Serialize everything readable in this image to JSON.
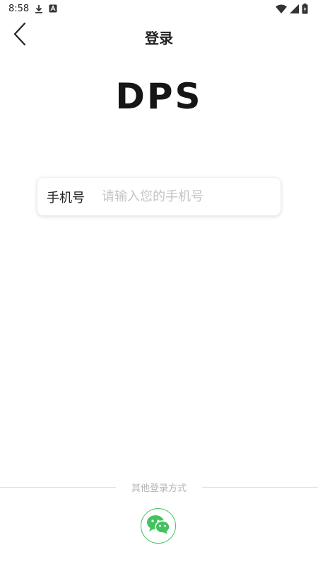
{
  "status_bar": {
    "time": "8:58"
  },
  "nav": {
    "title": "登录"
  },
  "logo": {
    "text": "DPS"
  },
  "phone": {
    "label": "手机号",
    "placeholder": "请输入您的手机号",
    "value": ""
  },
  "other_login": {
    "label": "其他登录方式"
  },
  "colors": {
    "wechat_green": "#43c25d",
    "divider": "#dcdcdc",
    "placeholder": "#c4c4c4"
  },
  "icons": [
    "download-icon",
    "app-notification-icon",
    "wifi-icon",
    "signal-icon",
    "battery-icon",
    "back-arrow-icon",
    "wechat-icon"
  ]
}
